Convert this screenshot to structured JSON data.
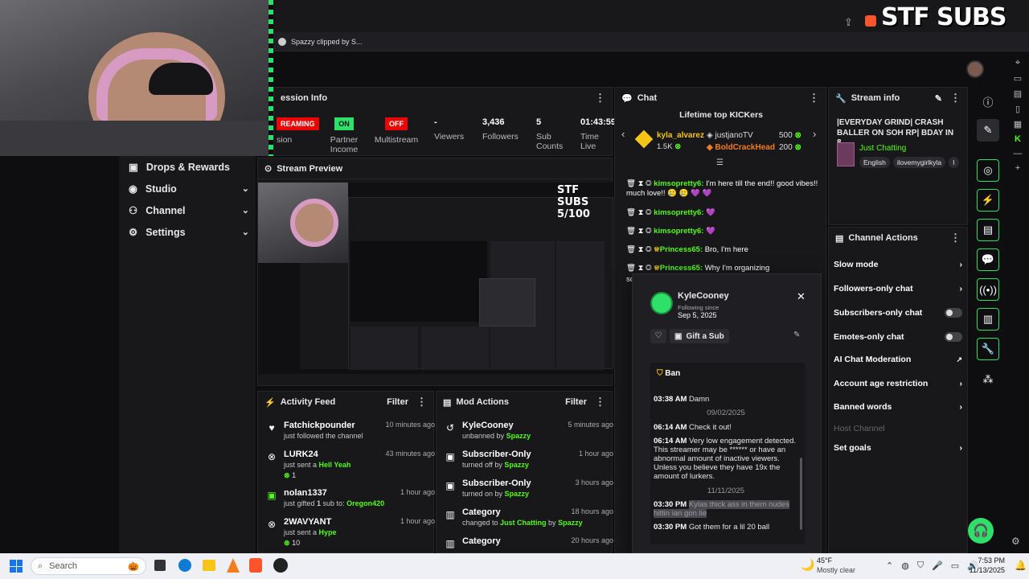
{
  "overlay": {
    "stream_title": "STF SUBS 5/100"
  },
  "browser": {
    "tab_label": "Spazzy clipped by S..."
  },
  "sidebar": {
    "items": [
      {
        "label": "Drops & Rewards",
        "icon": "gift-icon"
      },
      {
        "label": "Studio",
        "icon": "studio-icon"
      },
      {
        "label": "Channel",
        "icon": "channel-icon"
      },
      {
        "label": "Settings",
        "icon": "gear-icon"
      }
    ]
  },
  "session": {
    "title": "ession Info",
    "streaming_label": "REAMING",
    "session_sub": "sion",
    "partner_value": "ON",
    "partner_label": "Partner Income",
    "multistream_value": "OFF",
    "multistream_label": "Multistream",
    "viewers_value": "-",
    "viewers_label": "Viewers",
    "followers_value": "3,436",
    "followers_label": "Followers",
    "subs_value": "5",
    "subs_label": "Sub Counts",
    "time_value": "01:43:59",
    "time_label": "Time Live"
  },
  "preview": {
    "title": "Stream Preview"
  },
  "activity": {
    "title": "Activity Feed",
    "filter": "Filter",
    "items": [
      {
        "name": "Fatchickpounder",
        "sub": "just followed the channel",
        "time": "10 minutes ago"
      },
      {
        "name": "LURK24",
        "sub_prefix": "just sent a ",
        "sub_link": "Hell Yeah",
        "time": "43 minutes ago",
        "extra": "1"
      },
      {
        "name": "nolan1337",
        "sub_prefix": "just gifted ",
        "sub_count": "1",
        "sub_mid": " sub to: ",
        "sub_link": "Oregon420",
        "time": "1 hour ago"
      },
      {
        "name": "2WAVYANT",
        "sub_prefix": "just sent a ",
        "sub_link": "Hype",
        "time": "1 hour ago",
        "extra": "10"
      }
    ]
  },
  "mod": {
    "title": "Mod Actions",
    "filter": "Filter",
    "items": [
      {
        "name": "KyleCooney",
        "prefix": "unbanned by ",
        "by": "Spazzy",
        "time": "5 minutes ago"
      },
      {
        "name": "Subscriber-Only",
        "prefix": "turned off by ",
        "by": "Spazzy",
        "time": "1 hour ago"
      },
      {
        "name": "Subscriber-Only",
        "prefix": "turned on by ",
        "by": "Spazzy",
        "time": "3 hours ago"
      },
      {
        "name": "Category",
        "prefix": "changed to ",
        "link": "Just Chatting",
        "mid": " by ",
        "by": "Spazzy",
        "time": "18 hours ago"
      },
      {
        "name": "Category",
        "time": "20 hours ago"
      }
    ]
  },
  "chat": {
    "title": "Chat",
    "top_title": "Lifetime top KICKers",
    "top": [
      {
        "name": "kyla_alvarez",
        "amount": "1.5K"
      },
      {
        "name": "justjanoTV",
        "amount": "500"
      },
      {
        "name": "BoldCrackHead",
        "amount": "200"
      }
    ],
    "messages": [
      {
        "user": "kimsopretty6:",
        "text": " I'm here till the end!! good vibes!! much love!! 🥲 🥲 💜 💜"
      },
      {
        "user": "kimsopretty6:",
        "text": " 💜"
      },
      {
        "user": "kimsopretty6:",
        "text": " 💜"
      },
      {
        "user": "Princess65:",
        "text": " Bro, I'm here"
      },
      {
        "user": "Princess65:",
        "text": " Why I'm organizing"
      }
    ],
    "cut_text": "sc"
  },
  "user_card": {
    "username": "KyleCooney",
    "following_label": "Following since",
    "following_date": "Sep 5, 2025",
    "gift_label": "Gift a Sub",
    "ban_label": "Ban",
    "history": [
      {
        "time": "03:38 AM",
        "text": "Damn"
      },
      {
        "date": "09/02/2025"
      },
      {
        "time": "06:14 AM",
        "text": "Check it out!"
      },
      {
        "time": "06:14 AM",
        "text": "Very low engagement detected. This streamer may be ****** or have an abnormal amount of inactive viewers. Unless you believe they have 19x the amount of lurkers."
      },
      {
        "date": "11/11/2025"
      },
      {
        "time": "03:30 PM",
        "text": "Kylas thick ass in them nudes hittin ian gon lie"
      },
      {
        "time": "03:30 PM",
        "text": "Got them for a lil 20 ball"
      }
    ]
  },
  "stream_info": {
    "title": "Stream info",
    "stream_title": "|EVERYDAY GRIND| CRASH BALLER ON SOH RP| BDAY IN 8...",
    "category": "Just Chatting",
    "tags": [
      "English",
      "ilovemygirlkyla",
      "I"
    ]
  },
  "channel_actions": {
    "title": "Channel Actions",
    "items": [
      {
        "label": "Slow mode",
        "control": "chevron"
      },
      {
        "label": "Followers-only chat",
        "control": "chevron"
      },
      {
        "label": "Subscribers-only chat",
        "control": "toggle-off"
      },
      {
        "label": "Emotes-only chat",
        "control": "toggle-off"
      },
      {
        "label": "AI Chat Moderation",
        "control": "external"
      },
      {
        "label": "Account age restriction",
        "control": "chevron"
      },
      {
        "label": "Banned words",
        "control": "chevron"
      },
      {
        "label": "Host Channel",
        "control": "disabled"
      },
      {
        "label": "Set goals",
        "control": "chevron"
      }
    ]
  },
  "taskbar": {
    "search_placeholder": "Search",
    "weather_temp": "45°F",
    "weather_desc": "Mostly clear",
    "time": "7:53 PM",
    "date": "11/13/2025"
  },
  "colors": {
    "kick_green": "#53fc18",
    "live_red": "#eb0400",
    "panel_bg": "#18181b",
    "page_bg": "#0e0e10"
  }
}
